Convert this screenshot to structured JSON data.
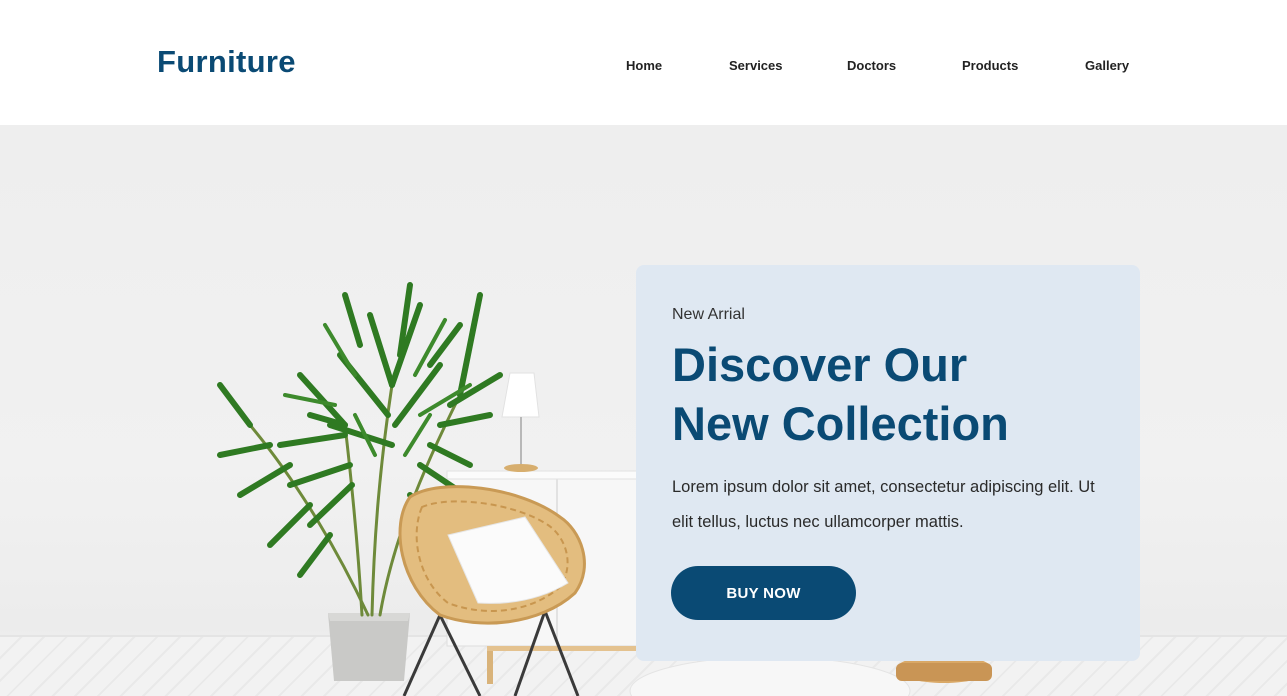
{
  "header": {
    "logo": "Furniture",
    "nav": [
      "Home",
      "Services",
      "Doctors",
      "Products",
      "Gallery"
    ]
  },
  "hero": {
    "eyebrow": "New Arrial",
    "headline_line1": "Discover Our",
    "headline_line2": "New Collection",
    "body": "Lorem ipsum dolor sit amet, consectetur adipiscing elit. Ut elit tellus, luctus nec ullamcorper mattis.",
    "cta": "BUY NOW"
  },
  "colors": {
    "brand": "#0a4a74",
    "card": "#dfe8f2",
    "wall": "#eeeeee"
  }
}
